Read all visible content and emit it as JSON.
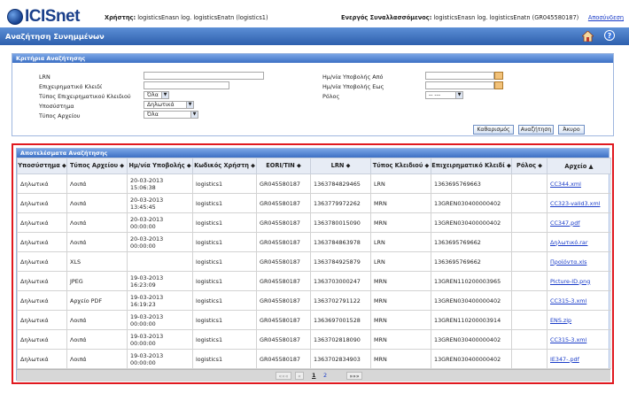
{
  "header": {
    "brand": "ICISnet",
    "user_label": "Χρήστης:",
    "user_value": "logisticsEnasn log. logisticsEnatn (logistics1)",
    "party_label": "Ενεργός Συναλλασσόμενος:",
    "party_value": "logisticsEnasn log. logisticsEnatn (GR045580187)",
    "logout": "Αποσύνδεση"
  },
  "page": {
    "title": "Αναζήτηση Συνημμένων"
  },
  "criteria": {
    "heading": "Κριτήρια Αναζήτησης",
    "lrn_label": "LRN",
    "business_key_label": "Επιχειρηματικό Κλειδί",
    "key_type_label": "Τύπος Επιχειρηματικού Κλειδιού",
    "key_type_value": "Όλα",
    "subsystem_label": "Υποσύστημα",
    "subsystem_value": "Δηλωτικά",
    "file_type_label": "Τύπος Αρχείου",
    "file_type_value": "Όλα",
    "date_from_label": "Ημ/νία Υποβολής Από",
    "date_to_label": "Ημ/νία Υποβολής Εως",
    "role_label": "Ρόλος",
    "role_value": "-- ---",
    "clear_button": "Καθαρισμός",
    "search_button": "Αναζήτηση",
    "cancel_button": "Άκυρο"
  },
  "results": {
    "heading": "Αποτελέσματα Αναζήτησης",
    "columns": [
      "Υποσύστημα ⬥",
      "Τύπος Αρχείου ⬥",
      "Ημ/νία Υποβολής ⬥",
      "Κωδικός Χρήστη ⬥",
      "EORI/TIN ⬥",
      "LRN ⬥",
      "Τύπος Κλειδιού ⬥",
      "Επιχειρηματικό Κλειδί ⬥",
      "Ρόλος ⬥",
      "Αρχείο ▲"
    ],
    "rows": [
      [
        "Δηλωτικά",
        "Λοιπά",
        "20-03-2013 15:06:38",
        "logistics1",
        "GR045580187",
        "1363784829465",
        "LRN",
        "1363695769663",
        "",
        "CC344.xml"
      ],
      [
        "Δηλωτικά",
        "Λοιπά",
        "20-03-2013 13:45:45",
        "logistics1",
        "GR045580187",
        "1363779972262",
        "MRN",
        "13GREN030400000402",
        "",
        "CC323-valid3.xml"
      ],
      [
        "Δηλωτικά",
        "Λοιπά",
        "20-03-2013 00:00:00",
        "logistics1",
        "GR045580187",
        "1363780015090",
        "MRN",
        "13GREN030400000402",
        "",
        "CC347.pdf"
      ],
      [
        "Δηλωτικά",
        "Λοιπά",
        "20-03-2013 00:00:00",
        "logistics1",
        "GR045580187",
        "1363784863978",
        "LRN",
        "1363695769662",
        "",
        "Δηλωτικό.rar"
      ],
      [
        "Δηλωτικά",
        "XLS",
        "",
        "logistics1",
        "GR045580187",
        "1363784925879",
        "LRN",
        "1363695769662",
        "",
        "Προϊόντα.xls"
      ],
      [
        "Δηλωτικά",
        "JPEG",
        "19-03-2013 16:23:09",
        "logistics1",
        "GR045580187",
        "1363703000247",
        "MRN",
        "13GREN110200003965",
        "",
        "Picture-ID.png"
      ],
      [
        "Δηλωτικά",
        "Αρχείο PDF",
        "19-03-2013 16:19:23",
        "logistics1",
        "GR045580187",
        "1363702791122",
        "MRN",
        "13GREN030400000402",
        "",
        "CC315-3.xml"
      ],
      [
        "Δηλωτικά",
        "Λοιπά",
        "19-03-2013 00:00:00",
        "logistics1",
        "GR045580187",
        "1363697001528",
        "MRN",
        "13GREN110200003914",
        "",
        "ENS.zip"
      ],
      [
        "Δηλωτικά",
        "Λοιπά",
        "19-03-2013 00:00:00",
        "logistics1",
        "GR045580187",
        "1363702818090",
        "MRN",
        "13GREN030400000402",
        "",
        "CC315-3.xml"
      ],
      [
        "Δηλωτικά",
        "Λοιπά",
        "19-03-2013 00:00:00",
        "logistics1",
        "GR045580187",
        "1363702834903",
        "MRN",
        "13GREN030400000402",
        "",
        "IE347-.pdf"
      ]
    ],
    "pager": {
      "first": "«««",
      "prev": "«",
      "page1": "1",
      "page2": "2",
      "last": "»»»"
    }
  }
}
